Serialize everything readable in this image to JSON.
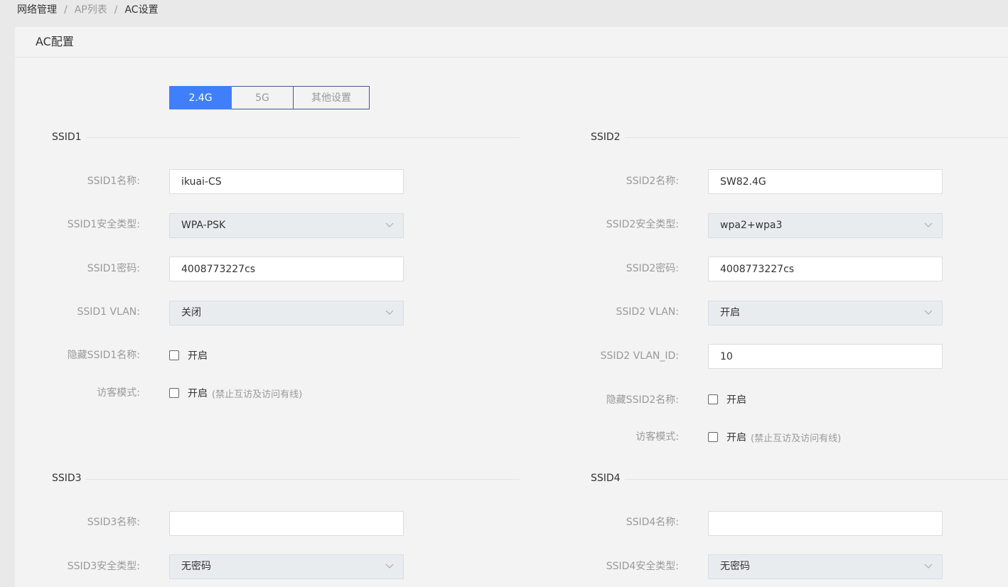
{
  "breadcrumb": {
    "items": [
      "网络管理",
      "AP列表",
      "AC设置"
    ],
    "sep": "/"
  },
  "panel": {
    "title": "AC配置"
  },
  "tabs": [
    "2.4G",
    "5G",
    "其他设置"
  ],
  "ssid1": {
    "title": "SSID1",
    "name_label": "SSID1名称:",
    "name_value": "ikuai-CS",
    "security_label": "SSID1安全类型:",
    "security_value": "WPA-PSK",
    "password_label": "SSID1密码:",
    "password_value": "4008773227cs",
    "vlan_label": "SSID1 VLAN:",
    "vlan_value": "关闭",
    "hide_label": "隐藏SSID1名称:",
    "hide_text": "开启",
    "guest_label": "访客模式:",
    "guest_text": "开启",
    "guest_hint": "(禁止互访及访问有线)"
  },
  "ssid2": {
    "title": "SSID2",
    "name_label": "SSID2名称:",
    "name_value": "SW82.4G",
    "security_label": "SSID2安全类型:",
    "security_value": "wpa2+wpa3",
    "password_label": "SSID2密码:",
    "password_value": "4008773227cs",
    "vlan_label": "SSID2 VLAN:",
    "vlan_value": "开启",
    "vlan_id_label": "SSID2 VLAN_ID:",
    "vlan_id_value": "10",
    "hide_label": "隐藏SSID2名称:",
    "hide_text": "开启",
    "guest_label": "访客模式:",
    "guest_text": "开启",
    "guest_hint": "(禁止互访及访问有线)"
  },
  "ssid3": {
    "title": "SSID3",
    "name_label": "SSID3名称:",
    "name_value": "",
    "security_label": "SSID3安全类型:",
    "security_value": "无密码"
  },
  "ssid4": {
    "title": "SSID4",
    "name_label": "SSID4名称:",
    "name_value": "",
    "security_label": "SSID4安全类型:",
    "security_value": "无密码"
  },
  "colors": {
    "accent": "#3f7ffb",
    "label": "#999999",
    "text": "#333333"
  }
}
